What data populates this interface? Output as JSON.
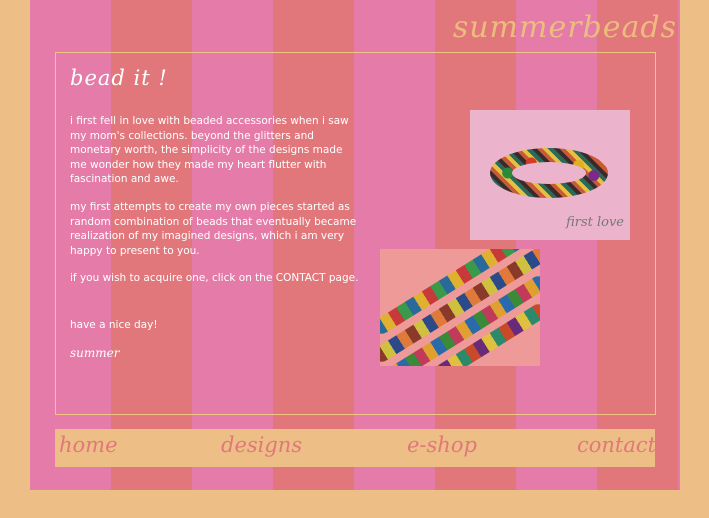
{
  "logo": "summerbeads",
  "heading": "bead it !",
  "paragraphs": [
    "i first fell in love with beaded accessories when i saw my mom's collections. beyond the glitters and monetary worth, the simplicity of the designs made me wonder how they made my heart flutter with fascination and awe.",
    "my first attempts to create my own pieces started as random combination of beads that eventually became realization of my imagined designs, which i am very happy to present to you.",
    "if you wish to acquire one, click on the CONTACT page.",
    "have a nice day!"
  ],
  "signature": "summer",
  "photo1_caption": "first love",
  "nav": [
    "home",
    "designs",
    "e-shop",
    "contact"
  ],
  "colors": {
    "background": "#EDBE86",
    "stripe_pink": "#E57BA8",
    "stripe_coral": "#E2777B",
    "text": "#FFFFFF"
  }
}
